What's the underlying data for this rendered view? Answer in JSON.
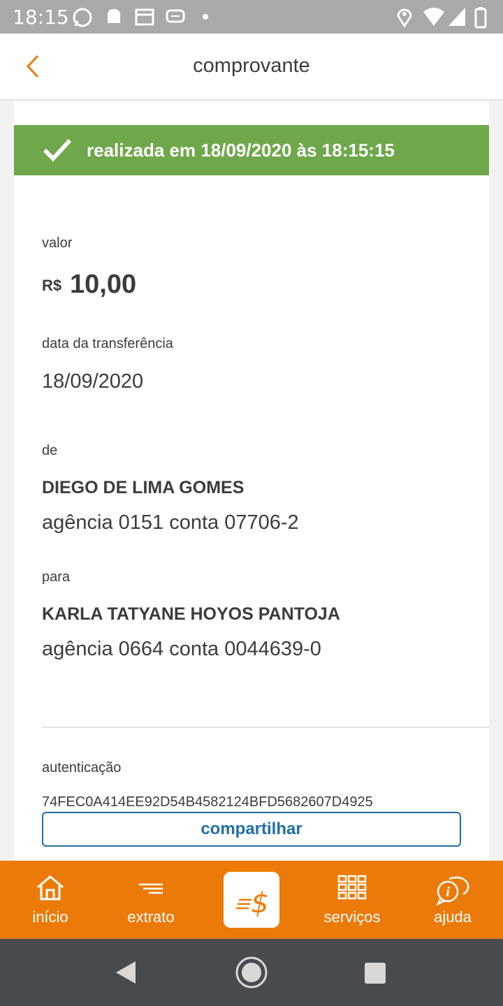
{
  "status_bar": {
    "time": "18:15"
  },
  "header": {
    "title": "comprovante"
  },
  "banner": {
    "text": "realizada em 18/09/2020 às 18:15:15"
  },
  "receipt": {
    "valor_label": "valor",
    "currency": "R$",
    "amount": "10,00",
    "date_label": "data da transferência",
    "date": "18/09/2020",
    "from_label": "de",
    "from_name": "DIEGO DE LIMA GOMES",
    "from_account": "agência 0151 conta 07706-2",
    "to_label": "para",
    "to_name": "KARLA TATYANE HOYOS PANTOJA",
    "to_account": "agência 0664 conta 0044639-0",
    "auth_label": "autenticação",
    "auth_code": "74FEC0A414EE92D54B4582124BFD5682607D4925",
    "share_label": "compartilhar"
  },
  "bottom_nav": {
    "items": [
      {
        "label": "início",
        "icon": "home-icon"
      },
      {
        "label": "extrato",
        "icon": "statement-icon"
      },
      {
        "label": "",
        "icon": "transfer-money-icon"
      },
      {
        "label": "serviços",
        "icon": "grid-icon"
      },
      {
        "label": "ajuda",
        "icon": "help-chat-icon"
      }
    ]
  },
  "colors": {
    "accent": "#ec7a08",
    "success": "#6fa84b",
    "link": "#1f6fa8",
    "status_bar": "#a9a9a9",
    "system_nav": "#474b50"
  }
}
